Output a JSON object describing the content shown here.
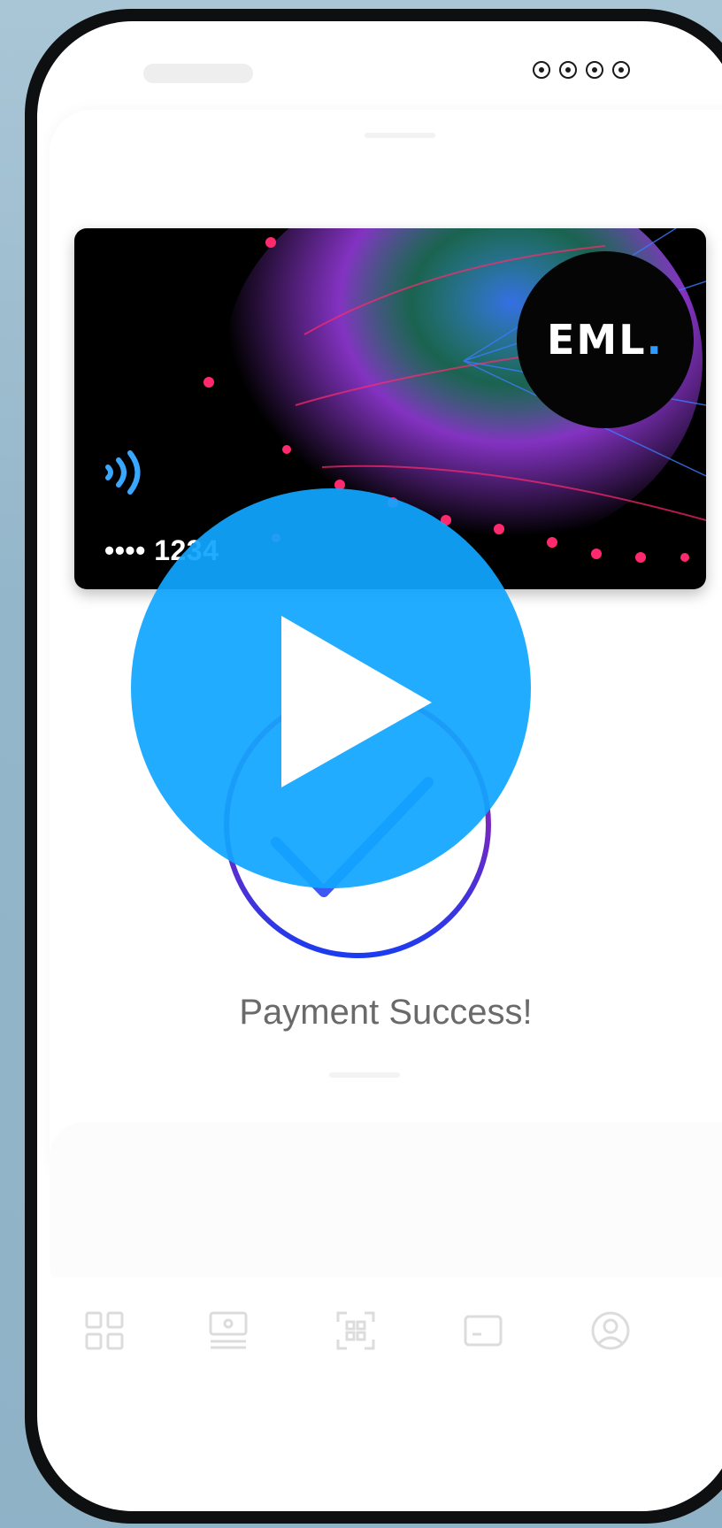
{
  "status_bar": {
    "indicator_count": 4,
    "icon": "signal-dots-icon"
  },
  "card": {
    "brand": "EML",
    "brand_dot": ".",
    "brand_dot_color": "#2f9bff",
    "masked_number": "•••• 1234",
    "contactless_icon": "nfc-contactless-icon",
    "art_colors": [
      "#ff2a6d",
      "#a43ff2",
      "#3b7bff",
      "#35c6a0"
    ]
  },
  "payment": {
    "status_text": "Payment Success!",
    "status_icon": "checkmark-circle-icon",
    "ring_gradient": [
      "#d4138f",
      "#1b3cf0"
    ]
  },
  "tab_bar": {
    "items": [
      {
        "icon": "grid-icon"
      },
      {
        "icon": "cash-icon"
      },
      {
        "icon": "qr-scan-icon"
      },
      {
        "icon": "card-icon"
      },
      {
        "icon": "profile-icon"
      }
    ]
  },
  "video_overlay": {
    "icon": "play-icon",
    "color": "#10a6ff"
  }
}
